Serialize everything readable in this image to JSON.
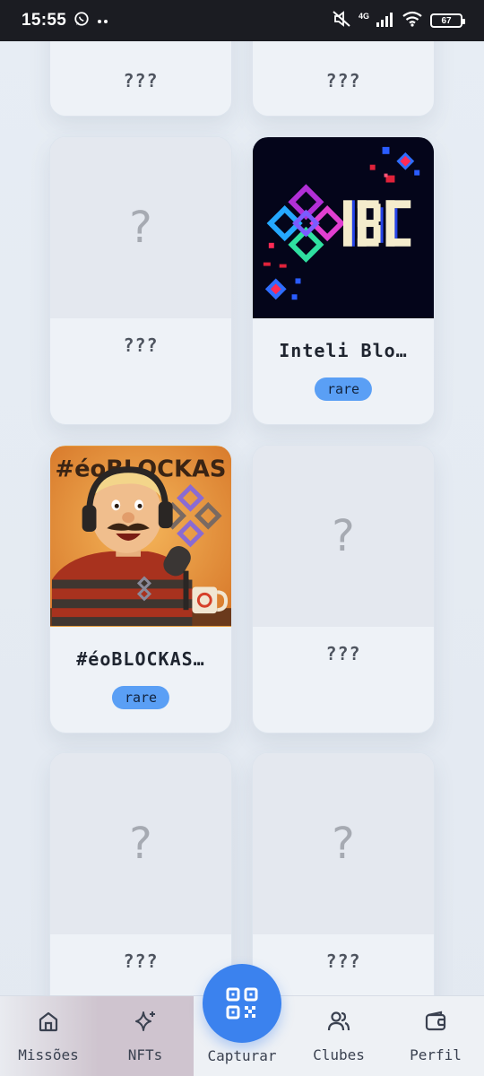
{
  "status_bar": {
    "time": "15:55",
    "network": "4G",
    "battery": "67"
  },
  "cards": [
    {
      "name": "???",
      "collected": false
    },
    {
      "name": "???",
      "collected": false
    },
    {
      "name": "???",
      "collected": false,
      "placeholder": "?"
    },
    {
      "name": "Inteli Blo…",
      "collected": true,
      "rarity": "rare",
      "artwork_text": "IBC"
    },
    {
      "name": "#éoBLOCKAS…",
      "collected": true,
      "rarity": "rare",
      "artwork_text": "#éoBLOCKAS"
    },
    {
      "name": "???",
      "collected": false,
      "placeholder": "?"
    },
    {
      "name": "???",
      "collected": false,
      "placeholder": "?"
    },
    {
      "name": "???",
      "collected": false,
      "placeholder": "?"
    }
  ],
  "bottom_nav": {
    "items": [
      {
        "label": "Missões",
        "icon": "home-icon"
      },
      {
        "label": "NFTs",
        "icon": "sparkles-icon"
      },
      {
        "label": "Clubes",
        "icon": "users-icon"
      },
      {
        "label": "Perfil",
        "icon": "wallet-icon"
      }
    ],
    "capture": {
      "label": "Capturar",
      "icon": "qr-code-icon"
    }
  },
  "colors": {
    "accent": "#3b82ee",
    "rarity_badge": "#5a9ff5",
    "active_tab": "#cfc4cf"
  }
}
